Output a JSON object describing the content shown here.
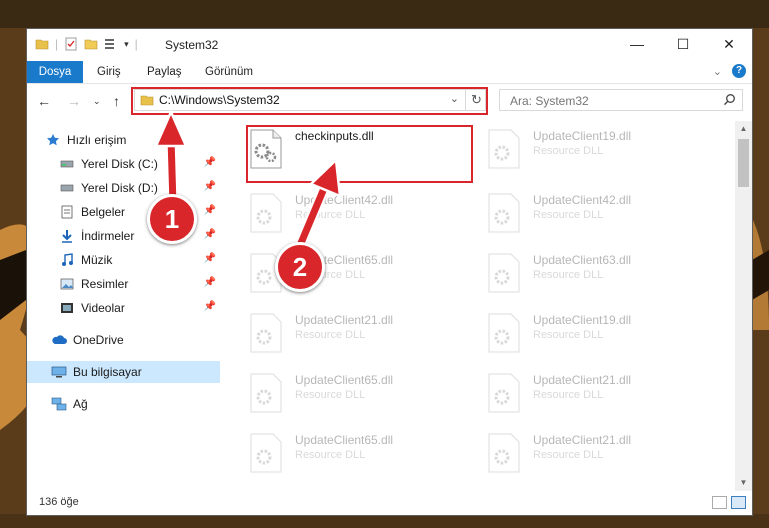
{
  "window": {
    "title": "System32",
    "controls": {
      "minimize": "—",
      "maximize": "☐",
      "close": "✕"
    }
  },
  "ribbon": {
    "tabs": [
      "Dosya",
      "Giriş",
      "Paylaş",
      "Görünüm"
    ]
  },
  "navigation": {
    "address_path": "C:\\Windows\\System32",
    "search_placeholder": "Ara: System32"
  },
  "sidebar": {
    "items": [
      {
        "label": "Hızlı erişim",
        "icon": "star-icon",
        "pinned": false
      },
      {
        "label": "Yerel Disk (C:)",
        "icon": "drive-icon",
        "pinned": true
      },
      {
        "label": "Yerel Disk (D:)",
        "icon": "drive-icon",
        "pinned": true
      },
      {
        "label": "Belgeler",
        "icon": "documents-icon",
        "pinned": true
      },
      {
        "label": "İndirmeler",
        "icon": "download-icon",
        "pinned": true
      },
      {
        "label": "Müzik",
        "icon": "music-icon",
        "pinned": true
      },
      {
        "label": "Resimler",
        "icon": "pictures-icon",
        "pinned": true
      },
      {
        "label": "Videolar",
        "icon": "video-icon",
        "pinned": true
      },
      {
        "label": "OneDrive",
        "icon": "cloud-icon",
        "pinned": false
      },
      {
        "label": "Bu bilgisayar",
        "icon": "computer-icon",
        "pinned": false,
        "selected": true
      },
      {
        "label": "Ağ",
        "icon": "network-icon",
        "pinned": false
      }
    ]
  },
  "files": [
    {
      "name": "checkinputs.dll",
      "type": ""
    },
    {
      "name": "UpdateClient19.dll",
      "type": "Resource DLL"
    },
    {
      "name": "UpdateClient42.dll",
      "type": "Resource DLL"
    },
    {
      "name": "UpdateClient42.dll",
      "type": "Resource DLL"
    },
    {
      "name": "UpdateClient65.dll",
      "type": "Resource DLL"
    },
    {
      "name": "UpdateClient63.dll",
      "type": "Resource DLL"
    },
    {
      "name": "UpdateClient21.dll",
      "type": "Resource DLL"
    },
    {
      "name": "UpdateClient19.dll",
      "type": "Resource DLL"
    },
    {
      "name": "UpdateClient65.dll",
      "type": "Resource DLL"
    },
    {
      "name": "UpdateClient21.dll",
      "type": "Resource DLL"
    },
    {
      "name": "UpdateClient65.dll",
      "type": "Resource DLL"
    },
    {
      "name": "UpdateClient21.dll",
      "type": "Resource DLL"
    }
  ],
  "status": {
    "item_count": "136 öğe"
  },
  "annotations": {
    "step1": "1",
    "step2": "2"
  },
  "colors": {
    "accent": "#1979ca",
    "highlight": "#d9262b",
    "selected": "#cce8ff"
  }
}
